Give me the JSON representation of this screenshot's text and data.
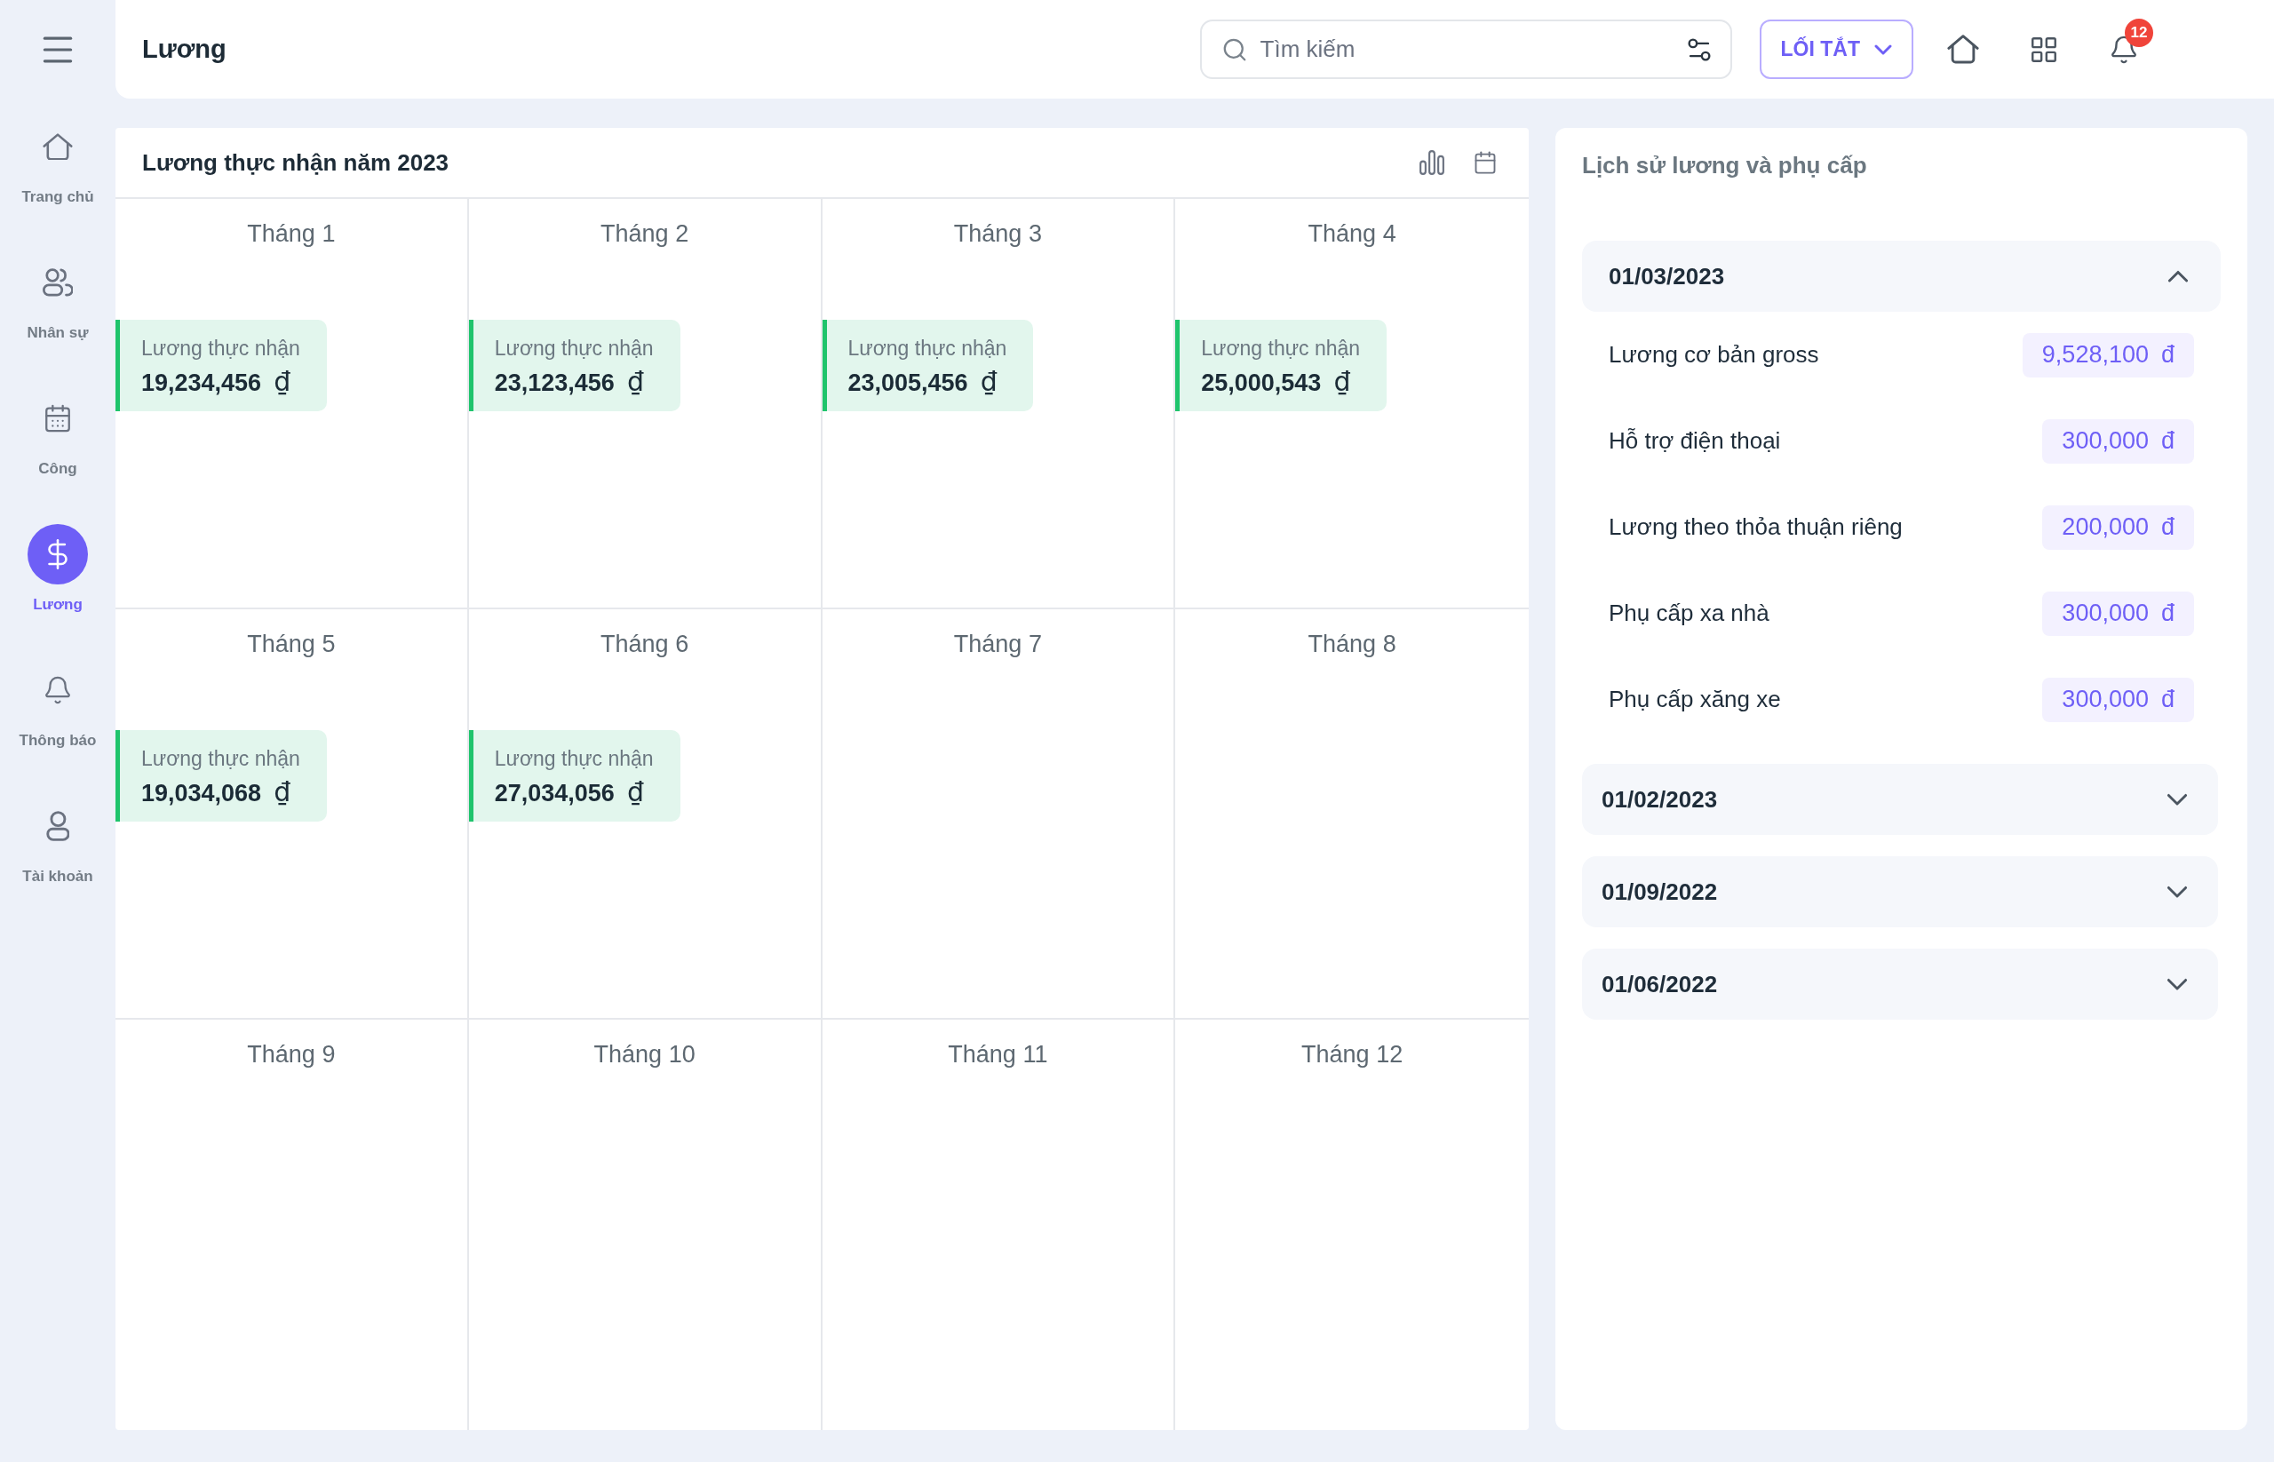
{
  "sidebar": {
    "items": [
      {
        "label": "Trang chủ",
        "selected": false
      },
      {
        "label": "Nhân sự",
        "selected": false
      },
      {
        "label": "Công",
        "selected": false
      },
      {
        "label": "Lương",
        "selected": true
      },
      {
        "label": "Thông báo",
        "selected": false
      },
      {
        "label": "Tài khoản",
        "selected": false
      }
    ]
  },
  "header": {
    "title": "Lương",
    "search": {
      "placeholder": "Tìm kiếm"
    },
    "shortcut_button": "LỐI TẮT",
    "notification_count": "12"
  },
  "salary_calendar": {
    "title": "Lương thực nhận năm 2023",
    "months": [
      {
        "label": "Tháng 1",
        "net_salary": {
          "label": "Lương thực nhận",
          "amount": "19,234,456",
          "currency": "₫"
        }
      },
      {
        "label": "Tháng 2",
        "net_salary": {
          "label": "Lương thực nhận",
          "amount": "23,123,456",
          "currency": "₫"
        }
      },
      {
        "label": "Tháng 3",
        "net_salary": {
          "label": "Lương thực nhận",
          "amount": "23,005,456",
          "currency": "₫"
        }
      },
      {
        "label": "Tháng 4",
        "net_salary": {
          "label": "Lương thực nhận",
          "amount": "25,000,543",
          "currency": "₫"
        }
      },
      {
        "label": "Tháng 5",
        "net_salary": {
          "label": "Lương thực nhận",
          "amount": "19,034,068",
          "currency": "₫"
        }
      },
      {
        "label": "Tháng 6",
        "net_salary": {
          "label": "Lương thực nhận",
          "amount": "27,034,056",
          "currency": "₫"
        }
      },
      {
        "label": "Tháng 7"
      },
      {
        "label": "Tháng 8"
      },
      {
        "label": "Tháng 9"
      },
      {
        "label": "Tháng 10"
      },
      {
        "label": "Tháng 11"
      },
      {
        "label": "Tháng 12"
      }
    ]
  },
  "history": {
    "title": "Lịch sử lương và phụ cấp",
    "periods": [
      {
        "date": "01/03/2023",
        "expanded": true,
        "items": [
          {
            "label": "Lương cơ bản gross",
            "amount": "9,528,100",
            "currency": "đ"
          },
          {
            "label": "Hỗ trợ điện thoại",
            "amount": "300,000",
            "currency": "đ"
          },
          {
            "label": "Lương theo thỏa thuận riêng",
            "amount": "200,000",
            "currency": "đ"
          },
          {
            "label": "Phụ cấp xa nhà",
            "amount": "300,000",
            "currency": "đ"
          },
          {
            "label": "Phụ cấp xăng xe",
            "amount": "300,000",
            "currency": "đ"
          }
        ]
      },
      {
        "date": "01/02/2023",
        "expanded": false
      },
      {
        "date": "01/09/2022",
        "expanded": false
      },
      {
        "date": "01/06/2022",
        "expanded": false
      }
    ]
  }
}
